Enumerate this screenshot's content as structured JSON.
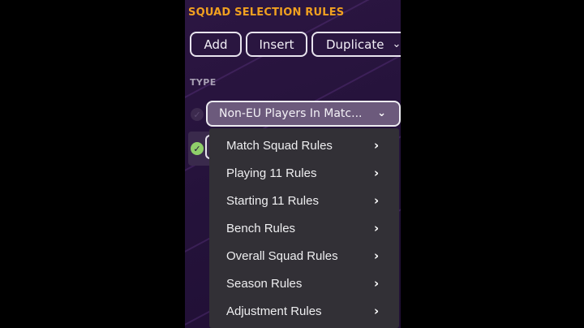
{
  "panel": {
    "title": "SQUAD SELECTION RULES",
    "type_label": "TYPE"
  },
  "toolbar": {
    "add_label": "Add",
    "insert_label": "Insert",
    "duplicate_label": "Duplicate"
  },
  "type_dropdown": {
    "selected": "Non-EU Players In Matc..."
  },
  "menu": {
    "items": [
      {
        "label": "Match Squad Rules"
      },
      {
        "label": "Playing 11 Rules"
      },
      {
        "label": "Starting 11 Rules"
      },
      {
        "label": "Bench Rules"
      },
      {
        "label": "Overall Squad Rules"
      },
      {
        "label": "Season Rules"
      },
      {
        "label": "Adjustment Rules"
      }
    ]
  },
  "icons": {
    "submenu_arrow": "chevron-right-icon",
    "dropdown_arrow": "chevron-down-icon",
    "rule_check": "check-icon"
  },
  "colors": {
    "title_accent": "#f0a020",
    "panel_bg": "#2c1642",
    "menu_bg": "#323036",
    "check_active": "#8fcf6a"
  }
}
